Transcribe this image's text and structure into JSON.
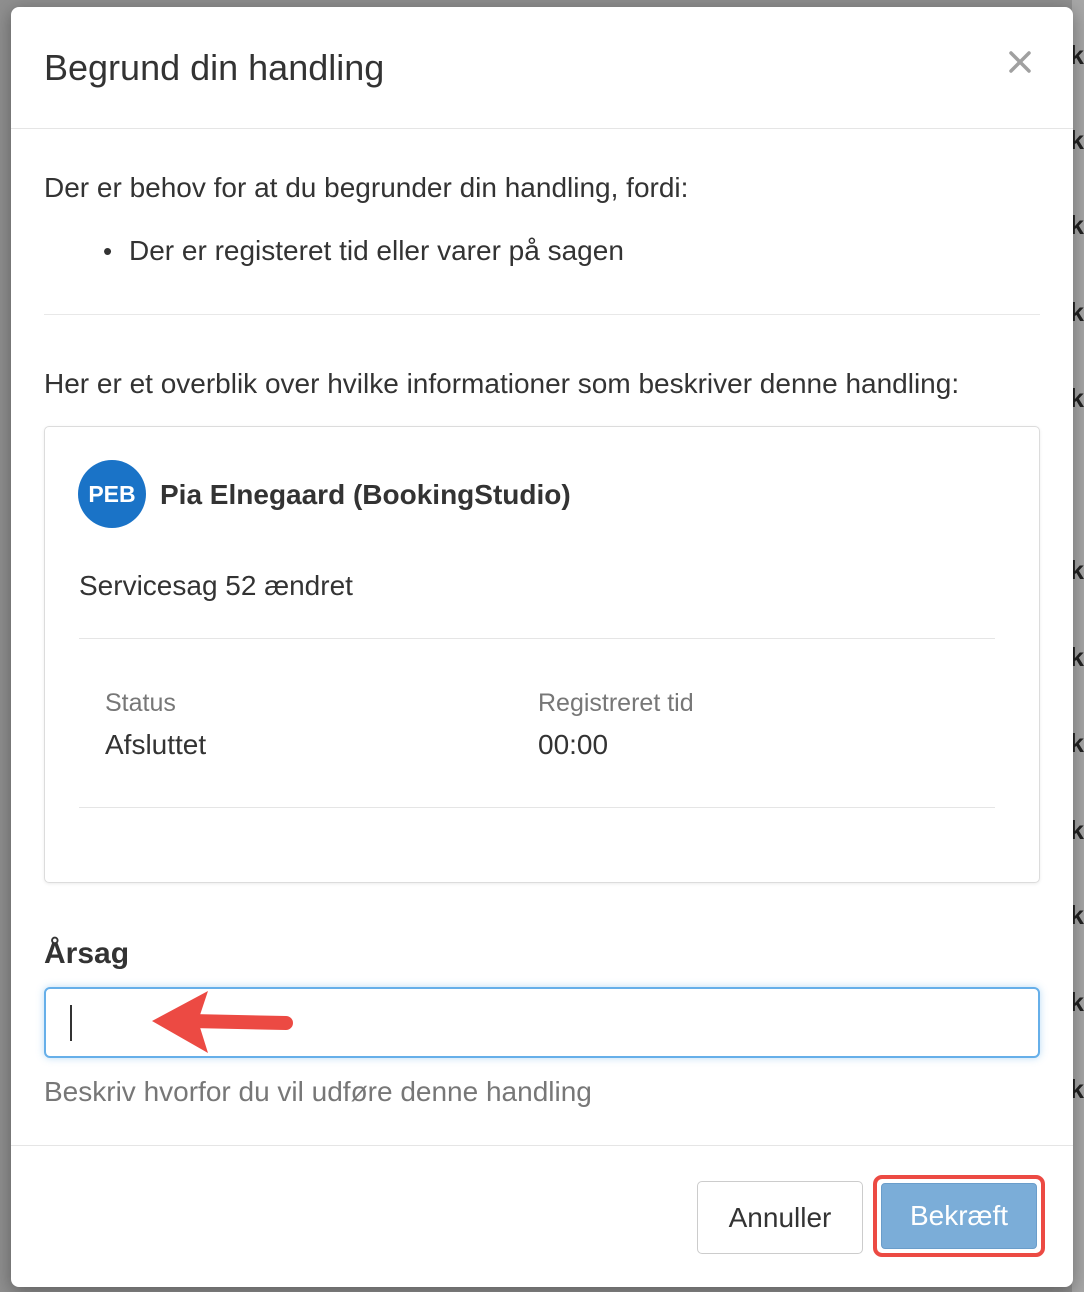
{
  "modal": {
    "title": "Begrund din handling",
    "close_icon": "close-icon"
  },
  "intro": {
    "text": "Der er behov for at du begrunder din handling, fordi:",
    "reasons": [
      "Der er registeret tid eller varer på sagen"
    ]
  },
  "overview": {
    "label": "Her er et overblik over hvilke informationer som beskriver denne handling:",
    "avatar_initials": "PEB",
    "avatar_color": "#1a73c7",
    "user_name": "Pia Elnegaard (BookingStudio)",
    "event": "Servicesag 52 ændret",
    "fields": [
      {
        "label": "Status",
        "value": "Afsluttet"
      },
      {
        "label": "Registreret tid",
        "value": "00:00"
      }
    ]
  },
  "reason_field": {
    "label": "Årsag",
    "value": "",
    "help": "Beskriv hvorfor du vil udføre denne handling"
  },
  "buttons": {
    "cancel": "Annuller",
    "confirm": "Bekræft"
  },
  "colors": {
    "confirm_button": "#7badd8",
    "highlight": "#ec4a43",
    "annotation_arrow": "#ec4a43"
  }
}
